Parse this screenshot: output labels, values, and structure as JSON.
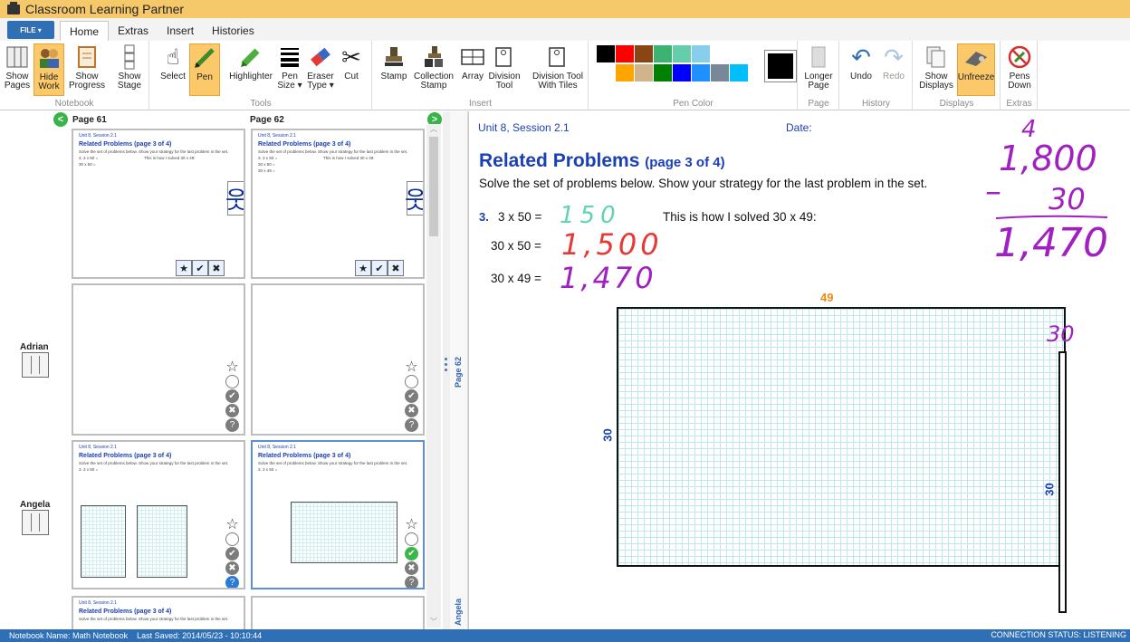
{
  "title": "Classroom Learning Partner",
  "tabs": {
    "file": "FILE ▾",
    "home": "Home",
    "extras": "Extras",
    "insert": "Insert",
    "histories": "Histories"
  },
  "ribbon": {
    "notebook": {
      "label": "Notebook",
      "show_pages": "Show\nPages",
      "hide_work": "Hide\nWork",
      "show_progress": "Show\nProgress",
      "show_stage": "Show\nStage"
    },
    "tools": {
      "label": "Tools",
      "select": "Select",
      "pen": "Pen",
      "highlighter": "Highlighter",
      "pen_size": "Pen\nSize ▾",
      "eraser_type": "Eraser\nType ▾",
      "cut": "Cut"
    },
    "insert": {
      "label": "Insert",
      "stamp": "Stamp",
      "collection_stamp": "Collection\nStamp",
      "array": "Array",
      "division_tool": "Division\nTool",
      "division_tool_tiles": "Division Tool\nWith Tiles"
    },
    "pen_color": {
      "label": "Pen Color",
      "swatches": [
        "#000000",
        "#ff0000",
        "#8b4513",
        "#3cb371",
        "#66cdaa",
        "#87ceeb",
        "#ffffff",
        "#ffffff",
        "#ffffff",
        "#ffffff",
        "#ffa500",
        "#d2b48c",
        "#008000",
        "#0000ff",
        "#1e90ff",
        "#778899",
        "#00bfff",
        "#ffffff"
      ],
      "selected": "#000000"
    },
    "page": {
      "label": "Page",
      "longer_page": "Longer\nPage"
    },
    "history": {
      "label": "History",
      "undo": "Undo",
      "redo": "Redo"
    },
    "displays": {
      "label": "Displays",
      "show_displays": "Show\nDisplays",
      "unfreeze": "Unfreeze"
    },
    "extras": {
      "label": "Extras",
      "pens_down": "Pens\nDown"
    }
  },
  "left_panel": {
    "page_61": "Page 61",
    "page_62": "Page 62",
    "students": [
      "Adrian",
      "Angela"
    ],
    "thumb": {
      "head_left": "Unit 8, Session 2.1",
      "head_right": "Date:",
      "title": "Related Problems (page 3 of 4)",
      "sub": "Solve the set of problems below. Show your strategy for the last problem in the set.",
      "q1": "3. 3 x 50 =",
      "q1b": "This is how I solved 30 x 49:",
      "q2": "30 x 50 =",
      "q3": "30 x 49 ="
    }
  },
  "side_labels": {
    "page": "Page 62",
    "student": "Angela"
  },
  "main": {
    "unit": "Unit 8, Session 2.1",
    "date": "Date:",
    "title": "Related Problems",
    "title_sub": "(page 3 of 4)",
    "subtitle": "Solve the set of problems below. Show your strategy for the last problem in the set.",
    "q_num": "3.",
    "q1": "3 x 50 =",
    "q1_answer": "150",
    "q1_text": "This is how I solved 30 x 49:",
    "q2": "30 x 50 =",
    "q2_answer": "1,500",
    "q3": "30 x 49 =",
    "q3_answer": "1,470",
    "array_top": "49",
    "array_side": "30",
    "bar_side": "30",
    "bar_top": "30",
    "work": {
      "carry": "4",
      "minuend": "1,800",
      "subtrahend": "30",
      "minus": "–",
      "result": "1,470"
    }
  },
  "status": {
    "left": "Notebook Name: Math Notebook    Last Saved: 2014/05/23 - 10:10:44",
    "right": "CONNECTION STATUS: LISTENING"
  }
}
